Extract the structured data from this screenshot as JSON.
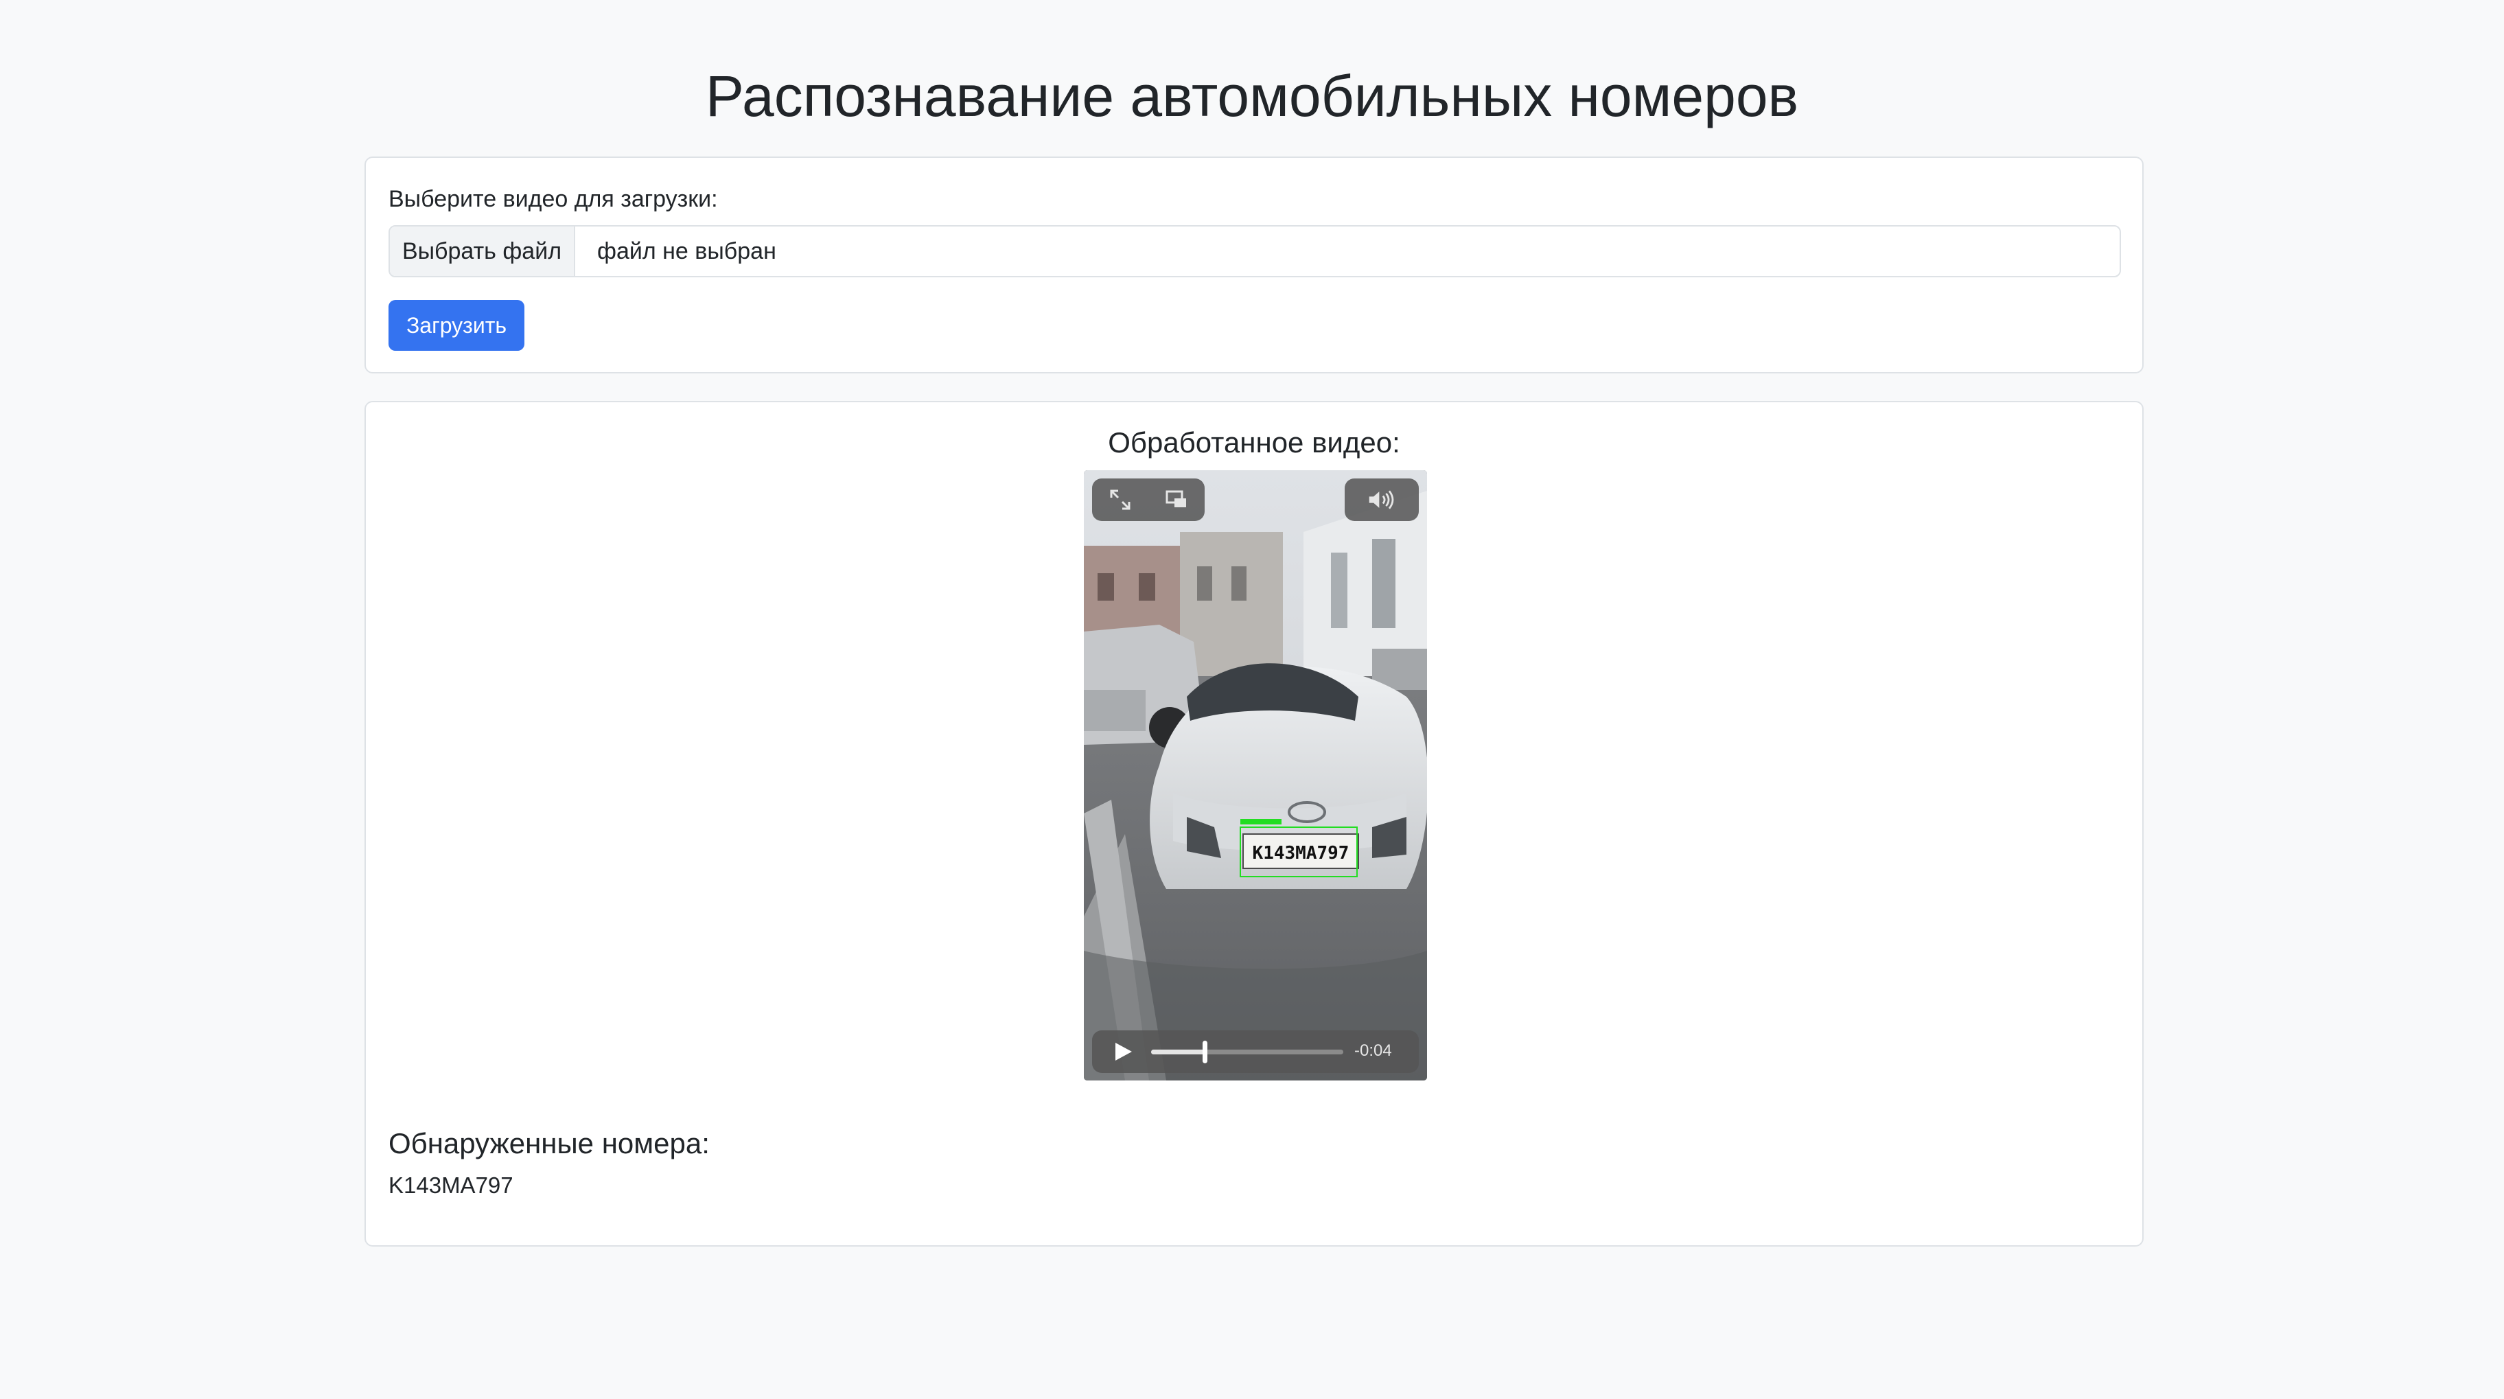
{
  "page": {
    "title": "Распознавание автомобильных номеров"
  },
  "upload": {
    "label": "Выберите видео для загрузки:",
    "choose_file_label": "Выбрать файл",
    "file_status": "файл не выбран",
    "submit_label": "Загрузить"
  },
  "result": {
    "video_heading": "Обработанное видео:",
    "video": {
      "time_remaining": "-0:04",
      "progress_fraction": 0.28,
      "overlay_plate_text": "К143МА797",
      "controls": {
        "fullscreen_icon": "expand-icon",
        "pip_icon": "picture-in-picture-icon",
        "volume_icon": "speaker-icon",
        "play_icon": "play-icon"
      }
    },
    "plates_heading": "Обнаруженные номера:",
    "plates": [
      "K143MA797"
    ]
  },
  "colors": {
    "page_background": "#f8f9fa",
    "primary_button": "#3473f0",
    "card_border": "#dee2e6",
    "detection_box": "#22dd22"
  }
}
